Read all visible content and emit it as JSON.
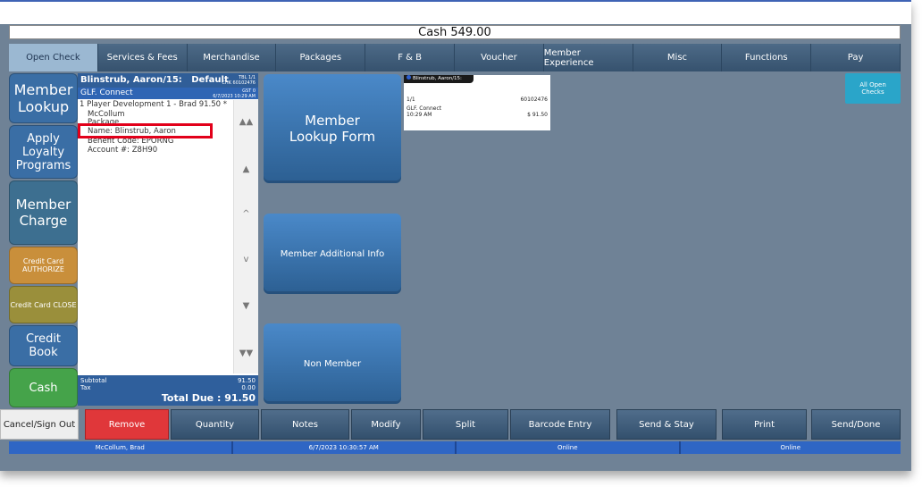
{
  "cash_bar": "Cash 549.00",
  "tabs": [
    "Open Check",
    "Services & Fees",
    "Merchandise",
    "Packages",
    "F & B",
    "Voucher",
    "Member Experience",
    "Misc",
    "Functions",
    "Pay"
  ],
  "side_buttons": [
    {
      "label": "Member Lookup",
      "color": "#3a6ea5"
    },
    {
      "label": "Apply Loyalty Programs",
      "color": "#3a6ea5"
    },
    {
      "label": "Member Charge",
      "color": "#3d6f90"
    },
    {
      "label": "Credit Card AUTHORIZE",
      "color": "#c98f3b"
    },
    {
      "label": "Credit Card CLOSE",
      "color": "#9a8f3b"
    },
    {
      "label": "Credit Book",
      "color": "#3a6ea5"
    },
    {
      "label": "Cash",
      "color": "#45a34a"
    }
  ],
  "check": {
    "header_name": "Blinstrub, Aaron/15:",
    "header_default": "Default",
    "tbl": "TBL 1/1",
    "chk": "CHK 60102476",
    "sub_name": "GLF. Connect",
    "gst": "GST 0",
    "date": "6/7/2023 10:29 AM",
    "item_line": "1  Player Development 1 - Brad  91.50  *",
    "item_line2": "McCollum",
    "package": "Package",
    "name_line": "Name: Blinstrub, Aaron",
    "benefit": "Benefit Code: EPORNG",
    "account": "Account #: Z8H90",
    "subtotal_label": "Subtotal",
    "subtotal_value": "91.50",
    "tax_label": "Tax",
    "tax_value": "0.00",
    "total_due": "Total Due :  91.50"
  },
  "big_buttons": [
    "Member Lookup Form",
    "Member Additional Info",
    "Non Member"
  ],
  "open_card": {
    "header": "Blinstrub, Aaron/15:",
    "seq": "1/1",
    "check_no": "60102476",
    "location": "GLF. Connect",
    "time": "10:29 AM",
    "amount": "$ 91.50"
  },
  "all_open": "All Open Checks",
  "bottom_buttons": [
    "Cancel/Sign Out",
    "Remove",
    "Quantity",
    "Notes",
    "Modify",
    "Split",
    "Barcode Entry",
    "Send & Stay",
    "Print",
    "Send/Done"
  ],
  "status": [
    "McCollum, Brad",
    "6/7/2023 10:30:57 AM",
    "Online",
    "Online"
  ]
}
